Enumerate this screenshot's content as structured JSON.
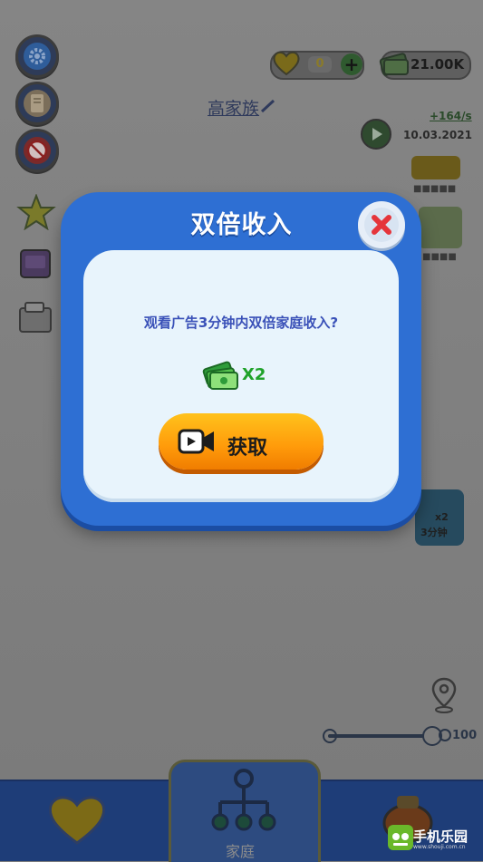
{
  "top_bar": {
    "hearts": "0",
    "money": "21.00K"
  },
  "family": {
    "name": "高家族",
    "rate": "+164/s",
    "date": "10.03.2021"
  },
  "boost": {
    "multiplier": "x2",
    "duration": "3分钟"
  },
  "zoom": {
    "value": "100"
  },
  "bottom_nav": {
    "family_label": "家庭"
  },
  "watermark": {
    "brand": "手机乐园",
    "url": "www.shouji.com.cn"
  },
  "modal": {
    "title": "双倍收入",
    "question": "观看广告3分钟内双倍家庭收入?",
    "reward": "X2",
    "button_label": "获取"
  },
  "colors": {
    "modal_blue": "#2e6fd3",
    "panel": "#e8f4fc",
    "button_orange": "#ff9a0a",
    "reward_green": "#1fa22a",
    "question_blue": "#3a51b8",
    "close_red": "#e5353b"
  }
}
